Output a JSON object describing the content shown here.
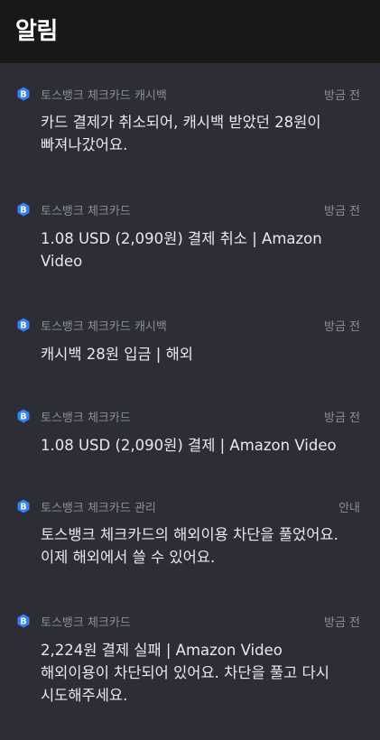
{
  "header": {
    "title": "알림"
  },
  "notifications": [
    {
      "source": "토스뱅크 체크카드 캐시백",
      "time": "방금 전",
      "lines": [
        "카드 결제가 취소되어, 캐시백 받았던 28원이",
        "빠져나갔어요."
      ]
    },
    {
      "source": "토스뱅크 체크카드",
      "time": "방금 전",
      "lines": [
        "1.08 USD (2,090원) 결제 취소 | Amazon",
        "Video"
      ]
    },
    {
      "source": "토스뱅크 체크카드 캐시백",
      "time": "방금 전",
      "lines": [
        "캐시백 28원 입금 | 해외"
      ]
    },
    {
      "source": "토스뱅크 체크카드",
      "time": "방금 전",
      "lines": [
        "1.08 USD (2,090원) 결제 | Amazon Video"
      ]
    },
    {
      "source": "토스뱅크 체크카드 관리",
      "time": "안내",
      "lines": [
        "토스뱅크 체크카드의 해외이용 차단을 풀었어요.",
        "이제 해외에서 쓸 수 있어요."
      ]
    },
    {
      "source": "토스뱅크 체크카드",
      "time": "방금 전",
      "lines": [
        "2,224원 결제 실패 | Amazon Video",
        "해외이용이 차단되어 있어요. 차단을 풀고 다시",
        "시도해주세요."
      ]
    }
  ],
  "colors": {
    "badge": "#3182f6",
    "background": "#2c2d35",
    "header": "#18181b"
  },
  "icon": "toss-bank-logo-icon"
}
